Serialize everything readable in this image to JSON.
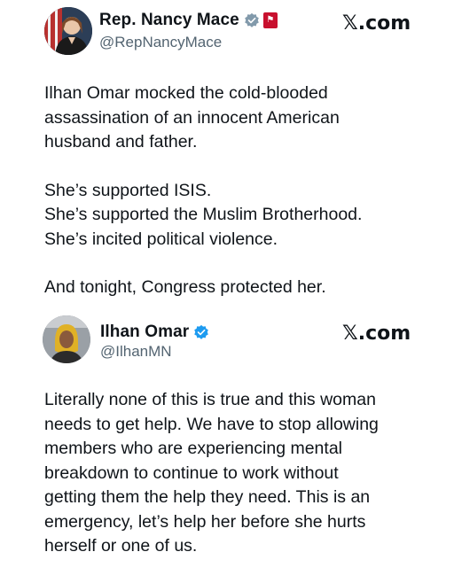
{
  "posts": [
    {
      "display_name": "Rep. Nancy Mace",
      "handle": "@RepNancyMace",
      "brand": "𝕏.com",
      "verified_badge": "gray-checkmark-icon",
      "affiliation_badge": "congress-flag-icon",
      "body_paragraphs": [
        [
          "Ilhan Omar mocked the cold-blooded",
          "assassination of an innocent American",
          "husband and father."
        ],
        [
          "She’s supported ISIS.",
          "She’s supported the Muslim Brotherhood.",
          "She’s incited political violence."
        ],
        [
          "And tonight, Congress protected her."
        ]
      ]
    },
    {
      "display_name": "Ilhan Omar",
      "handle": "@IlhanMN",
      "brand": "𝕏.com",
      "verified_badge": "blue-checkmark-icon",
      "body_paragraphs": [
        [
          "Literally none of this is true and this woman",
          "needs to get help. We have to stop allowing",
          "members who are experiencing mental",
          "breakdown to continue to work without",
          "getting them the help they need. This is an",
          "emergency, let’s help her before she hurts",
          "herself or one of us."
        ]
      ]
    }
  ],
  "colors": {
    "text": "#0f1419",
    "muted": "#536471",
    "blue_check": "#1d9bf0",
    "gray_check": "#829aab"
  }
}
